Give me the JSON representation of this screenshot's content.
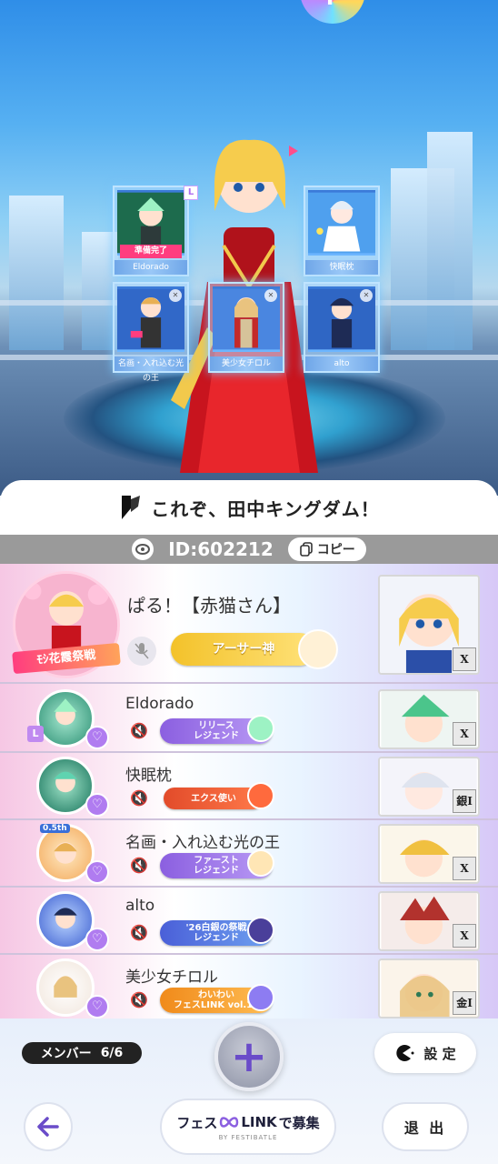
{
  "banner": {
    "text": "これぞ、田中キングダム！"
  },
  "room": {
    "id_text": "ID:602212",
    "copy_label": "コピー"
  },
  "party_cards": [
    {
      "name": "Eldorado",
      "status": "準備完了",
      "badge": "L"
    },
    {
      "name": "快眠枕"
    },
    {
      "name": "名画・入れ込む光の王"
    },
    {
      "name": "美少女チロル"
    },
    {
      "name": "alto"
    }
  ],
  "leader": {
    "name": "ぱる！【赤猫さん】",
    "title": "アーサー神",
    "avatar_frame_text": "ﾓｼ花霞祭戦"
  },
  "members": [
    {
      "name": "Eldorado",
      "title_line1": "リリース",
      "title_line2": "レジェンド",
      "title_color": "#8b5fe0",
      "rank": "X",
      "leader_tag": "L"
    },
    {
      "name": "快眠枕",
      "title_line1": "エクス使い",
      "title_line2": "",
      "title_color": "#e24b2a",
      "rank": "銀I"
    },
    {
      "name": "名画・入れ込む光の王",
      "title_line1": "ファースト",
      "title_line2": "レジェンド",
      "title_color": "#8b5fe0",
      "rank": "X",
      "avatar_frame_text": "0.5th"
    },
    {
      "name": "alto",
      "title_line1": "'26白銀の祭戦",
      "title_line2": "レジェンド",
      "title_color": "#4a5fd8",
      "rank": "X"
    },
    {
      "name": "美少女チロル",
      "title_line1": "わいわい",
      "title_line2": "フェスLINK vol.11",
      "title_color": "#f08a1a",
      "rank": "金I"
    }
  ],
  "controls": {
    "member_label": "メンバー",
    "member_count": "6/6",
    "settings_label": "設 定",
    "recruit_brand": "フェス",
    "recruit_link": "LINK",
    "recruit_suffix": "で募集",
    "recruit_sub": "BY FESTIBATLE",
    "exit_label": "退 出"
  },
  "colors": {
    "accent": "#8b5fe0",
    "ready": "#ff3d7f",
    "idbar": "#9a9a9a"
  }
}
